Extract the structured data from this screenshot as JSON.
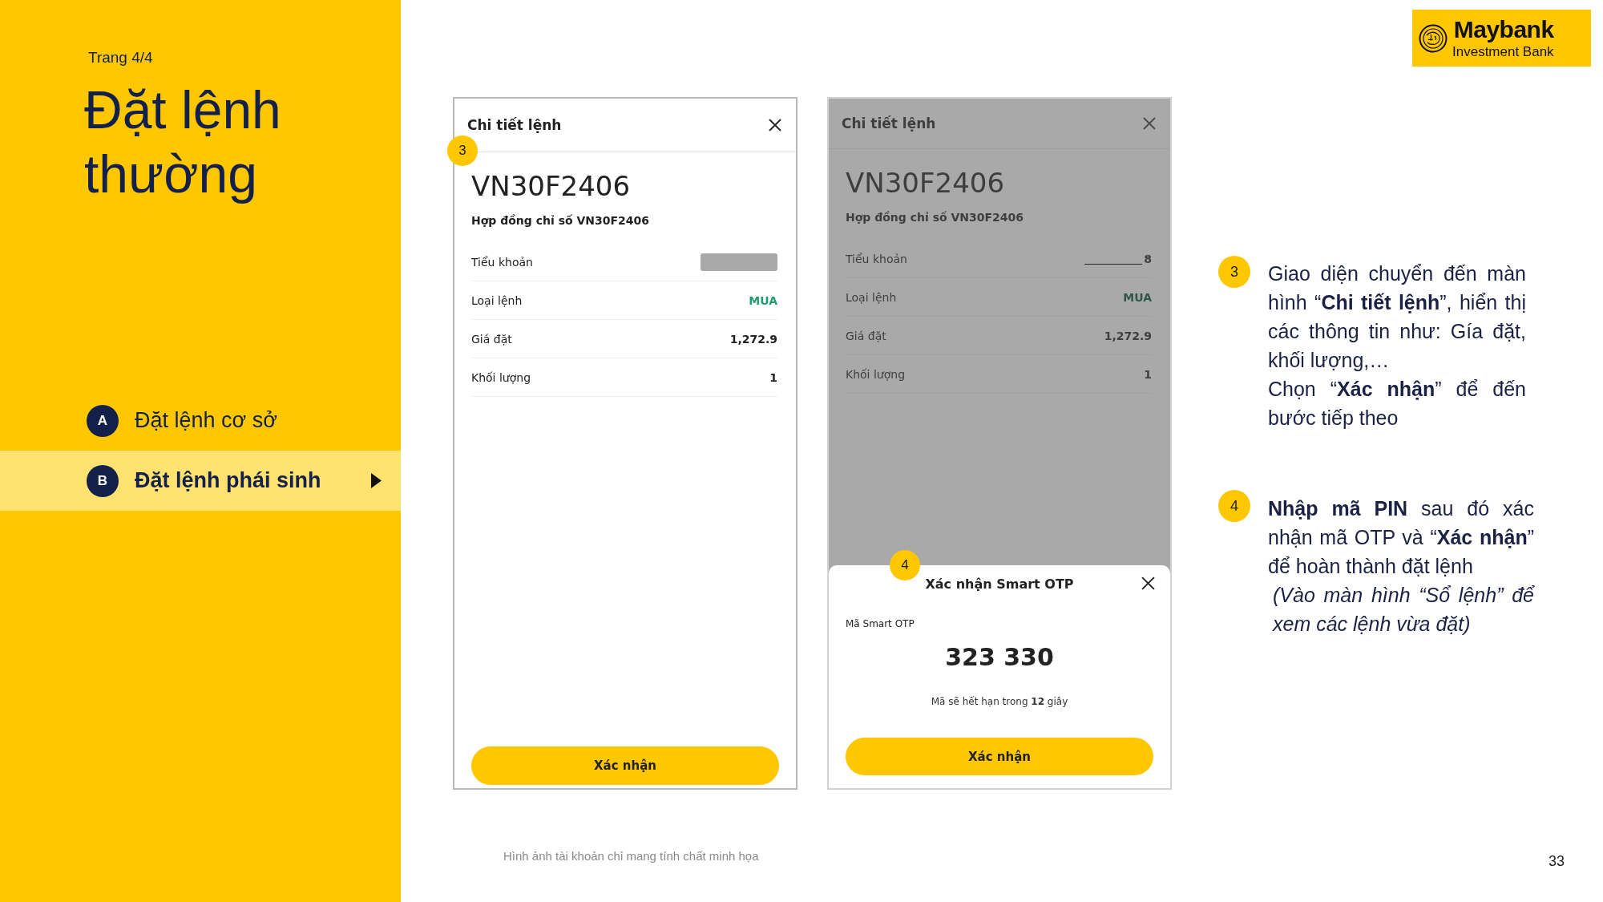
{
  "sidebar": {
    "page_label": "Trang 4/4",
    "title": "Đặt lệnh thường",
    "items": [
      {
        "marker": "A",
        "label": "Đặt lệnh cơ sở",
        "selected": false
      },
      {
        "marker": "B",
        "label": "Đặt lệnh phái sinh",
        "selected": true
      }
    ]
  },
  "logo": {
    "wordmark": "Maybank",
    "subtitle": "Investment Bank"
  },
  "screens": [
    {
      "dimmed": false,
      "badge": "3",
      "title": "Chi tiết lệnh",
      "symbol": "VN30F2406",
      "description": "Hợp đồng chỉ số VN30F2406",
      "rows": [
        {
          "label": "Tiểu khoản",
          "kind": "redacted"
        },
        {
          "label": "Loại lệnh",
          "value": "MUA",
          "kind": "buy"
        },
        {
          "label": "Giá đặt",
          "value": "1,272.9",
          "kind": "text"
        },
        {
          "label": "Khối lượng",
          "value": "1",
          "kind": "text"
        }
      ],
      "button": "Xác nhận"
    },
    {
      "dimmed": true,
      "title": "Chi tiết lệnh",
      "symbol": "VN30F2406",
      "description": "Hợp đồng chỉ số VN30F2406",
      "rows": [
        {
          "label": "Tiểu khoản",
          "value": "8",
          "kind": "masked"
        },
        {
          "label": "Loại lệnh",
          "value": "MUA",
          "kind": "buy"
        },
        {
          "label": "Giá đặt",
          "value": "1,272.9",
          "kind": "text"
        },
        {
          "label": "Khối lượng",
          "value": "1",
          "kind": "text"
        }
      ],
      "sheet": {
        "badge": "4",
        "title": "Xác nhận Smart OTP",
        "code_label": "Mã Smart OTP",
        "code": "323 330",
        "expiry": "Mã sẽ hết hạn trong **12** giây",
        "button": "Xác nhận"
      }
    }
  ],
  "steps": [
    {
      "badge": "3",
      "paragraphs": [
        {
          "kind": "body",
          "text": "Giao diện chuyển đến màn hình “**Chi tiết lệnh**”, hiển thị các thông tin như: Gía đặt, khối lượng,…"
        },
        {
          "kind": "body",
          "text": "Chọn “**Xác nhận**” để đến bước tiếp theo"
        }
      ]
    },
    {
      "badge": "4",
      "paragraphs": [
        {
          "kind": "body",
          "text": "**Nhập mã PIN** sau đó xác nhận mã OTP và “**Xác nhận**” để hoàn thành đặt lệnh"
        },
        {
          "kind": "note",
          "text": "(Vào màn hình “Sổ lệnh” để xem các lệnh vừa đặt)"
        }
      ]
    }
  ],
  "footer": {
    "note": "Hình ảnh tài khoản chỉ mang tính chất minh họa",
    "page_number": "33"
  }
}
